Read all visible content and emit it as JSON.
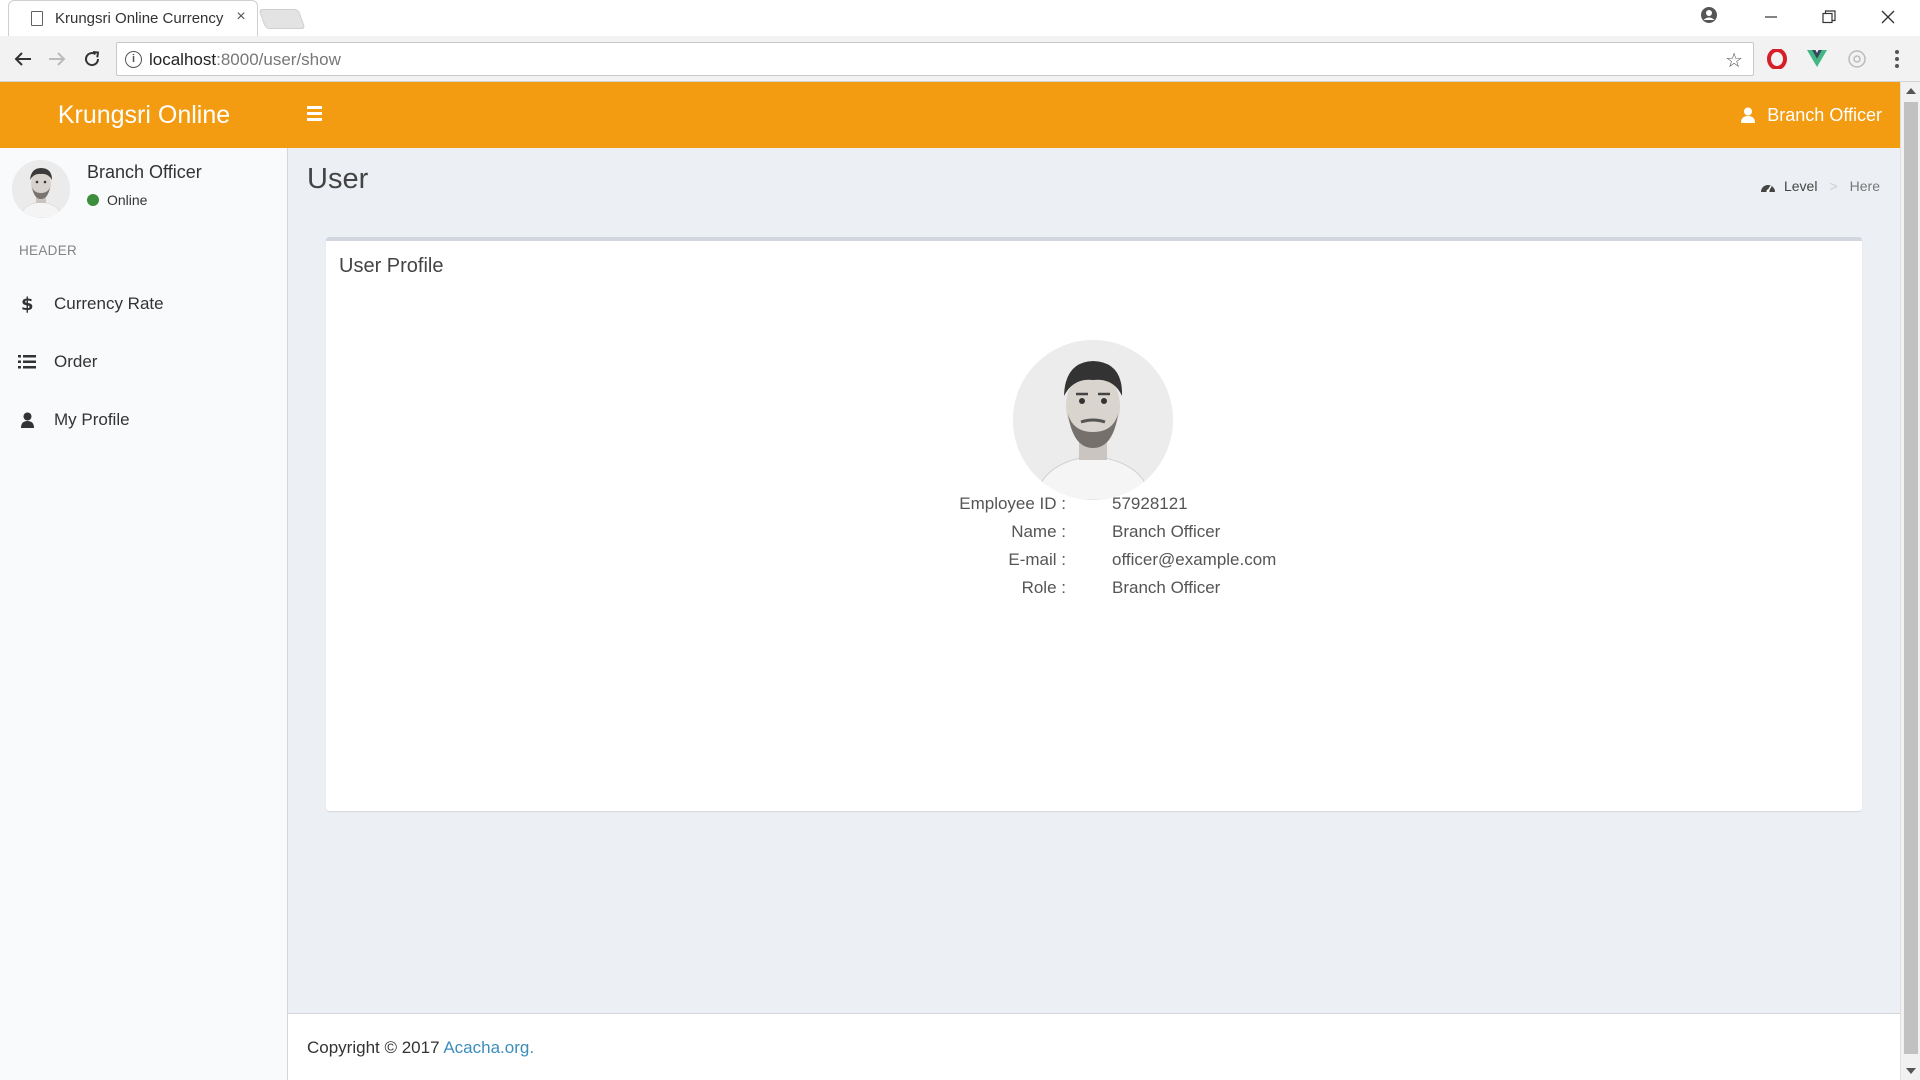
{
  "browser": {
    "tab_title": "Krungsri Online Currency",
    "tab_close": "×",
    "url_host": "localhost",
    "url_path": ":8000/user/show"
  },
  "app": {
    "brand": "Krungsri Online",
    "header_user": "Branch Officer",
    "accent_color": "#f39c12"
  },
  "sidebar": {
    "user_name": "Branch Officer",
    "user_status": "Online",
    "section_header": "HEADER",
    "items": [
      {
        "label": "Currency Rate",
        "icon": "dollar-icon"
      },
      {
        "label": "Order",
        "icon": "list-icon"
      },
      {
        "label": "My Profile",
        "icon": "user-icon"
      }
    ]
  },
  "content": {
    "title": "User",
    "breadcrumb_level": "Level",
    "breadcrumb_sep": ">",
    "breadcrumb_here": "Here"
  },
  "profile": {
    "box_title": "User Profile",
    "fields": [
      {
        "key": "Employee ID :",
        "value": "57928121"
      },
      {
        "key": "Name :",
        "value": "Branch Officer"
      },
      {
        "key": "E-mail :",
        "value": "officer@example.com"
      },
      {
        "key": "Role :",
        "value": "Branch Officer"
      }
    ]
  },
  "footer": {
    "copyright": "Copyright © 2017",
    "link": "Acacha.org."
  }
}
